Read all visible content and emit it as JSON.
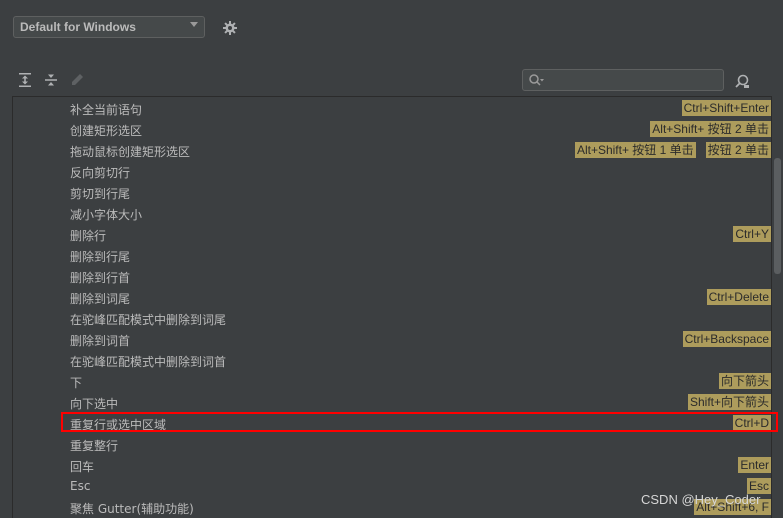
{
  "header": {
    "scheme_value": "Default for Windows",
    "settings_icon": "gear-icon"
  },
  "toolbar": {
    "icons": [
      "expand-all-icon",
      "collapse-all-icon",
      "edit-icon"
    ],
    "search_icon": "search-icon",
    "search_value": "",
    "find_shortcut_icon": "find-action-by-shortcut-icon"
  },
  "actions": [
    {
      "name": "补全当前语句",
      "keys": [
        "Ctrl+Shift+Enter"
      ]
    },
    {
      "name": "创建矩形选区",
      "keys": [
        "Alt+Shift+ 按钮 2 单击"
      ]
    },
    {
      "name": "拖动鼠标创建矩形选区",
      "keys": [
        "Alt+Shift+ 按钮 1 单击",
        "按钮 2 单击"
      ]
    },
    {
      "name": "反向剪切行",
      "keys": []
    },
    {
      "name": "剪切到行尾",
      "keys": []
    },
    {
      "name": "减小字体大小",
      "keys": []
    },
    {
      "name": "删除行",
      "keys": [
        "Ctrl+Y"
      ]
    },
    {
      "name": "删除到行尾",
      "keys": []
    },
    {
      "name": "删除到行首",
      "keys": []
    },
    {
      "name": "删除到词尾",
      "keys": [
        "Ctrl+Delete"
      ]
    },
    {
      "name": "在驼峰匹配模式中删除到词尾",
      "keys": []
    },
    {
      "name": "删除到词首",
      "keys": [
        "Ctrl+Backspace"
      ]
    },
    {
      "name": "在驼峰匹配模式中删除到词首",
      "keys": []
    },
    {
      "name": "下",
      "keys": [
        "向下箭头"
      ]
    },
    {
      "name": "向下选中",
      "keys": [
        "Shift+向下箭头"
      ]
    },
    {
      "name": "重复行或选中区域",
      "keys": [
        "Ctrl+D"
      ],
      "highlighted": true
    },
    {
      "name": "重复整行",
      "keys": []
    },
    {
      "name": "回车",
      "keys": [
        "Enter"
      ]
    },
    {
      "name": "Esc",
      "keys": [
        "Esc"
      ]
    },
    {
      "name": "聚焦 Gutter(辅助功能)",
      "keys": [
        "Alt+Shift+6, F"
      ]
    }
  ],
  "colors": {
    "background": "#3c3f41",
    "text": "#bbbbbb",
    "shortcut_badge": "#ad9c5c",
    "highlight_border": "#ff0000"
  },
  "watermark": "CSDN @Hey_Coder"
}
